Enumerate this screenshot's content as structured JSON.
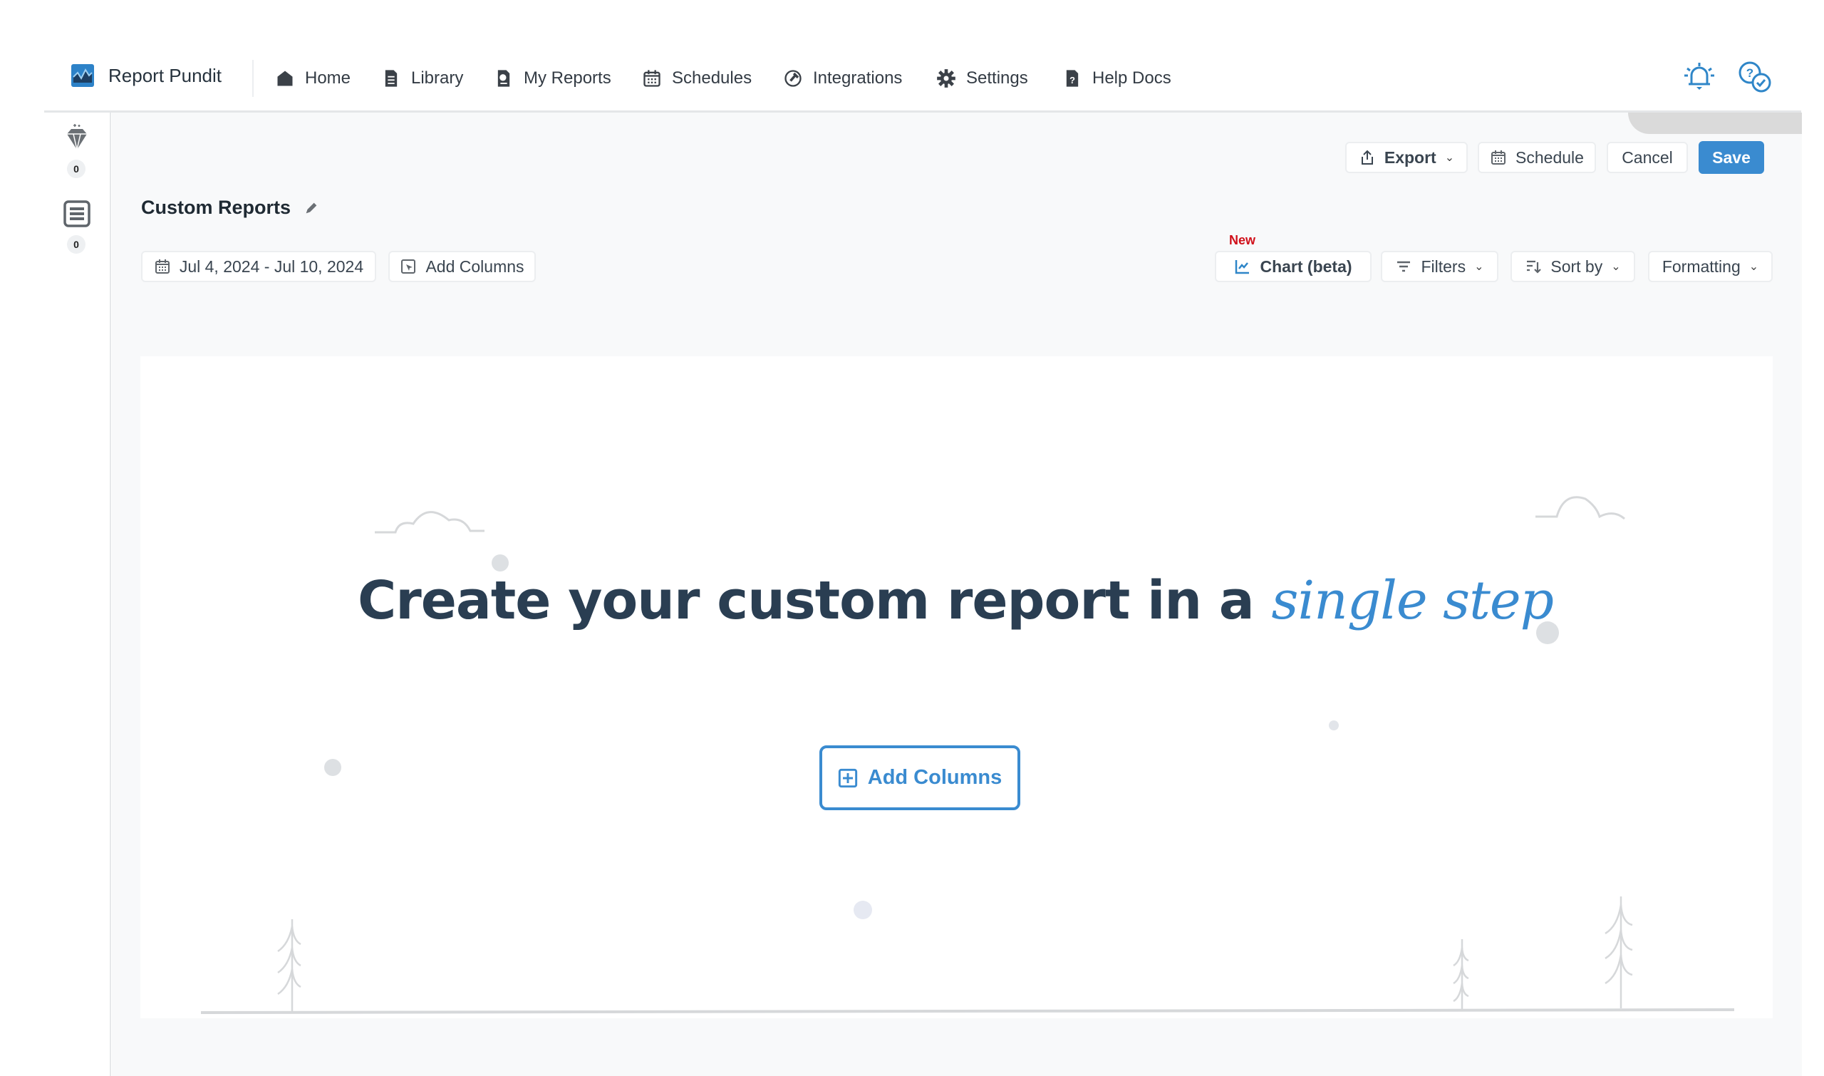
{
  "nav": {
    "brand": "Report Pundit",
    "items": [
      {
        "label": "Home",
        "icon": "home-icon"
      },
      {
        "label": "Library",
        "icon": "library-icon"
      },
      {
        "label": "My Reports",
        "icon": "reports-icon"
      },
      {
        "label": "Schedules",
        "icon": "calendar-icon"
      },
      {
        "label": "Integrations",
        "icon": "integrations-icon"
      },
      {
        "label": "Settings",
        "icon": "gear-icon"
      },
      {
        "label": "Help Docs",
        "icon": "help-doc-icon"
      }
    ]
  },
  "sidebar": {
    "items": [
      {
        "icon": "diamond-icon",
        "count": "0"
      },
      {
        "icon": "list-icon",
        "count": "0"
      }
    ]
  },
  "toolbar": {
    "export": "Export",
    "schedule": "Schedule",
    "cancel": "Cancel",
    "save": "Save"
  },
  "report": {
    "title": "Custom Reports",
    "date_range": "Jul 4, 2024 - Jul 10, 2024",
    "add_columns": "Add Columns",
    "new_badge": "New",
    "chart": "Chart (beta)",
    "filters": "Filters",
    "sort_by": "Sort by",
    "formatting": "Formatting"
  },
  "empty_state": {
    "headline": "Create your custom report in a ",
    "headline_accent": "single step",
    "button": "Add Columns"
  },
  "colors": {
    "accent": "#3a8bd0",
    "new_badge": "#d0101a",
    "headline": "#2a3e52"
  }
}
